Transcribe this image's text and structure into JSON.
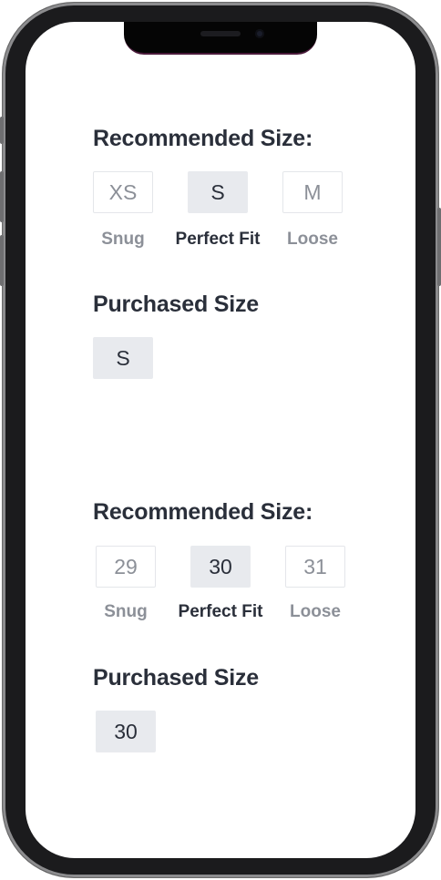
{
  "shirt": {
    "recommended_heading": "Recommended Size:",
    "options": [
      {
        "size": "XS",
        "fit": "Snug",
        "selected": false
      },
      {
        "size": "S",
        "fit": "Perfect Fit",
        "selected": true
      },
      {
        "size": "M",
        "fit": "Loose",
        "selected": false
      }
    ],
    "purchased_heading": "Purchased Size",
    "purchased_size": "S"
  },
  "pants": {
    "recommended_heading": "Recommended Size:",
    "options": [
      {
        "size": "29",
        "fit": "Snug",
        "selected": false
      },
      {
        "size": "30",
        "fit": "Perfect Fit",
        "selected": true
      },
      {
        "size": "31",
        "fit": "Loose",
        "selected": false
      }
    ],
    "purchased_heading": "Purchased Size",
    "purchased_size": "30"
  },
  "colors": {
    "heading": "#2a2f3a",
    "muted": "#8c9098",
    "selected_bg": "#e8eaee",
    "box_border": "#e4e6ea",
    "frame": "#1b1b1d"
  }
}
